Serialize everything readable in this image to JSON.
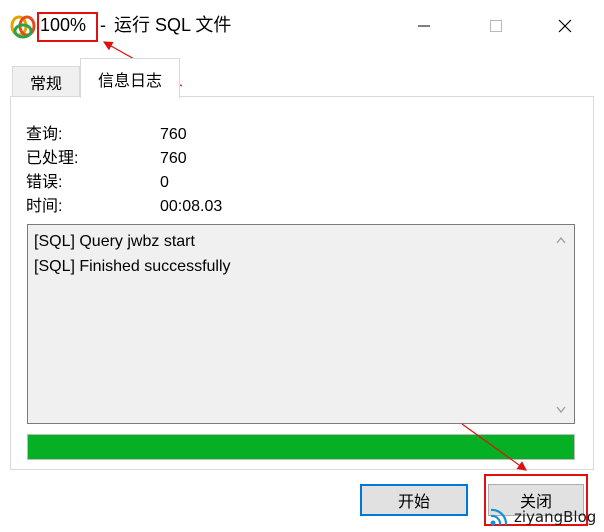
{
  "titlebar": {
    "percent": "100%",
    "separator": "-",
    "title": "运行 SQL 文件"
  },
  "tabs": [
    {
      "label": "常规",
      "active": false
    },
    {
      "label": "信息日志",
      "active": true
    }
  ],
  "stats": [
    {
      "label": "查询:",
      "value": "760"
    },
    {
      "label": "已处理:",
      "value": "760"
    },
    {
      "label": "错误:",
      "value": "0"
    },
    {
      "label": "时间:",
      "value": "00:08.03"
    }
  ],
  "log": {
    "lines": [
      "[SQL] Query jwbz start",
      "[SQL] Finished successfully"
    ]
  },
  "progress": {
    "value_fraction": 1.0
  },
  "buttons": {
    "start": "开始",
    "close": "关闭"
  },
  "watermark": {
    "text": "ziyangBlog"
  },
  "colors": {
    "progress": "#06b025",
    "annotation": "#e01010",
    "focus_border": "#0078d7"
  },
  "icons": {
    "app": "navicat-app-icon",
    "minimize": "minimize-icon",
    "maximize": "maximize-icon",
    "close": "close-icon"
  }
}
